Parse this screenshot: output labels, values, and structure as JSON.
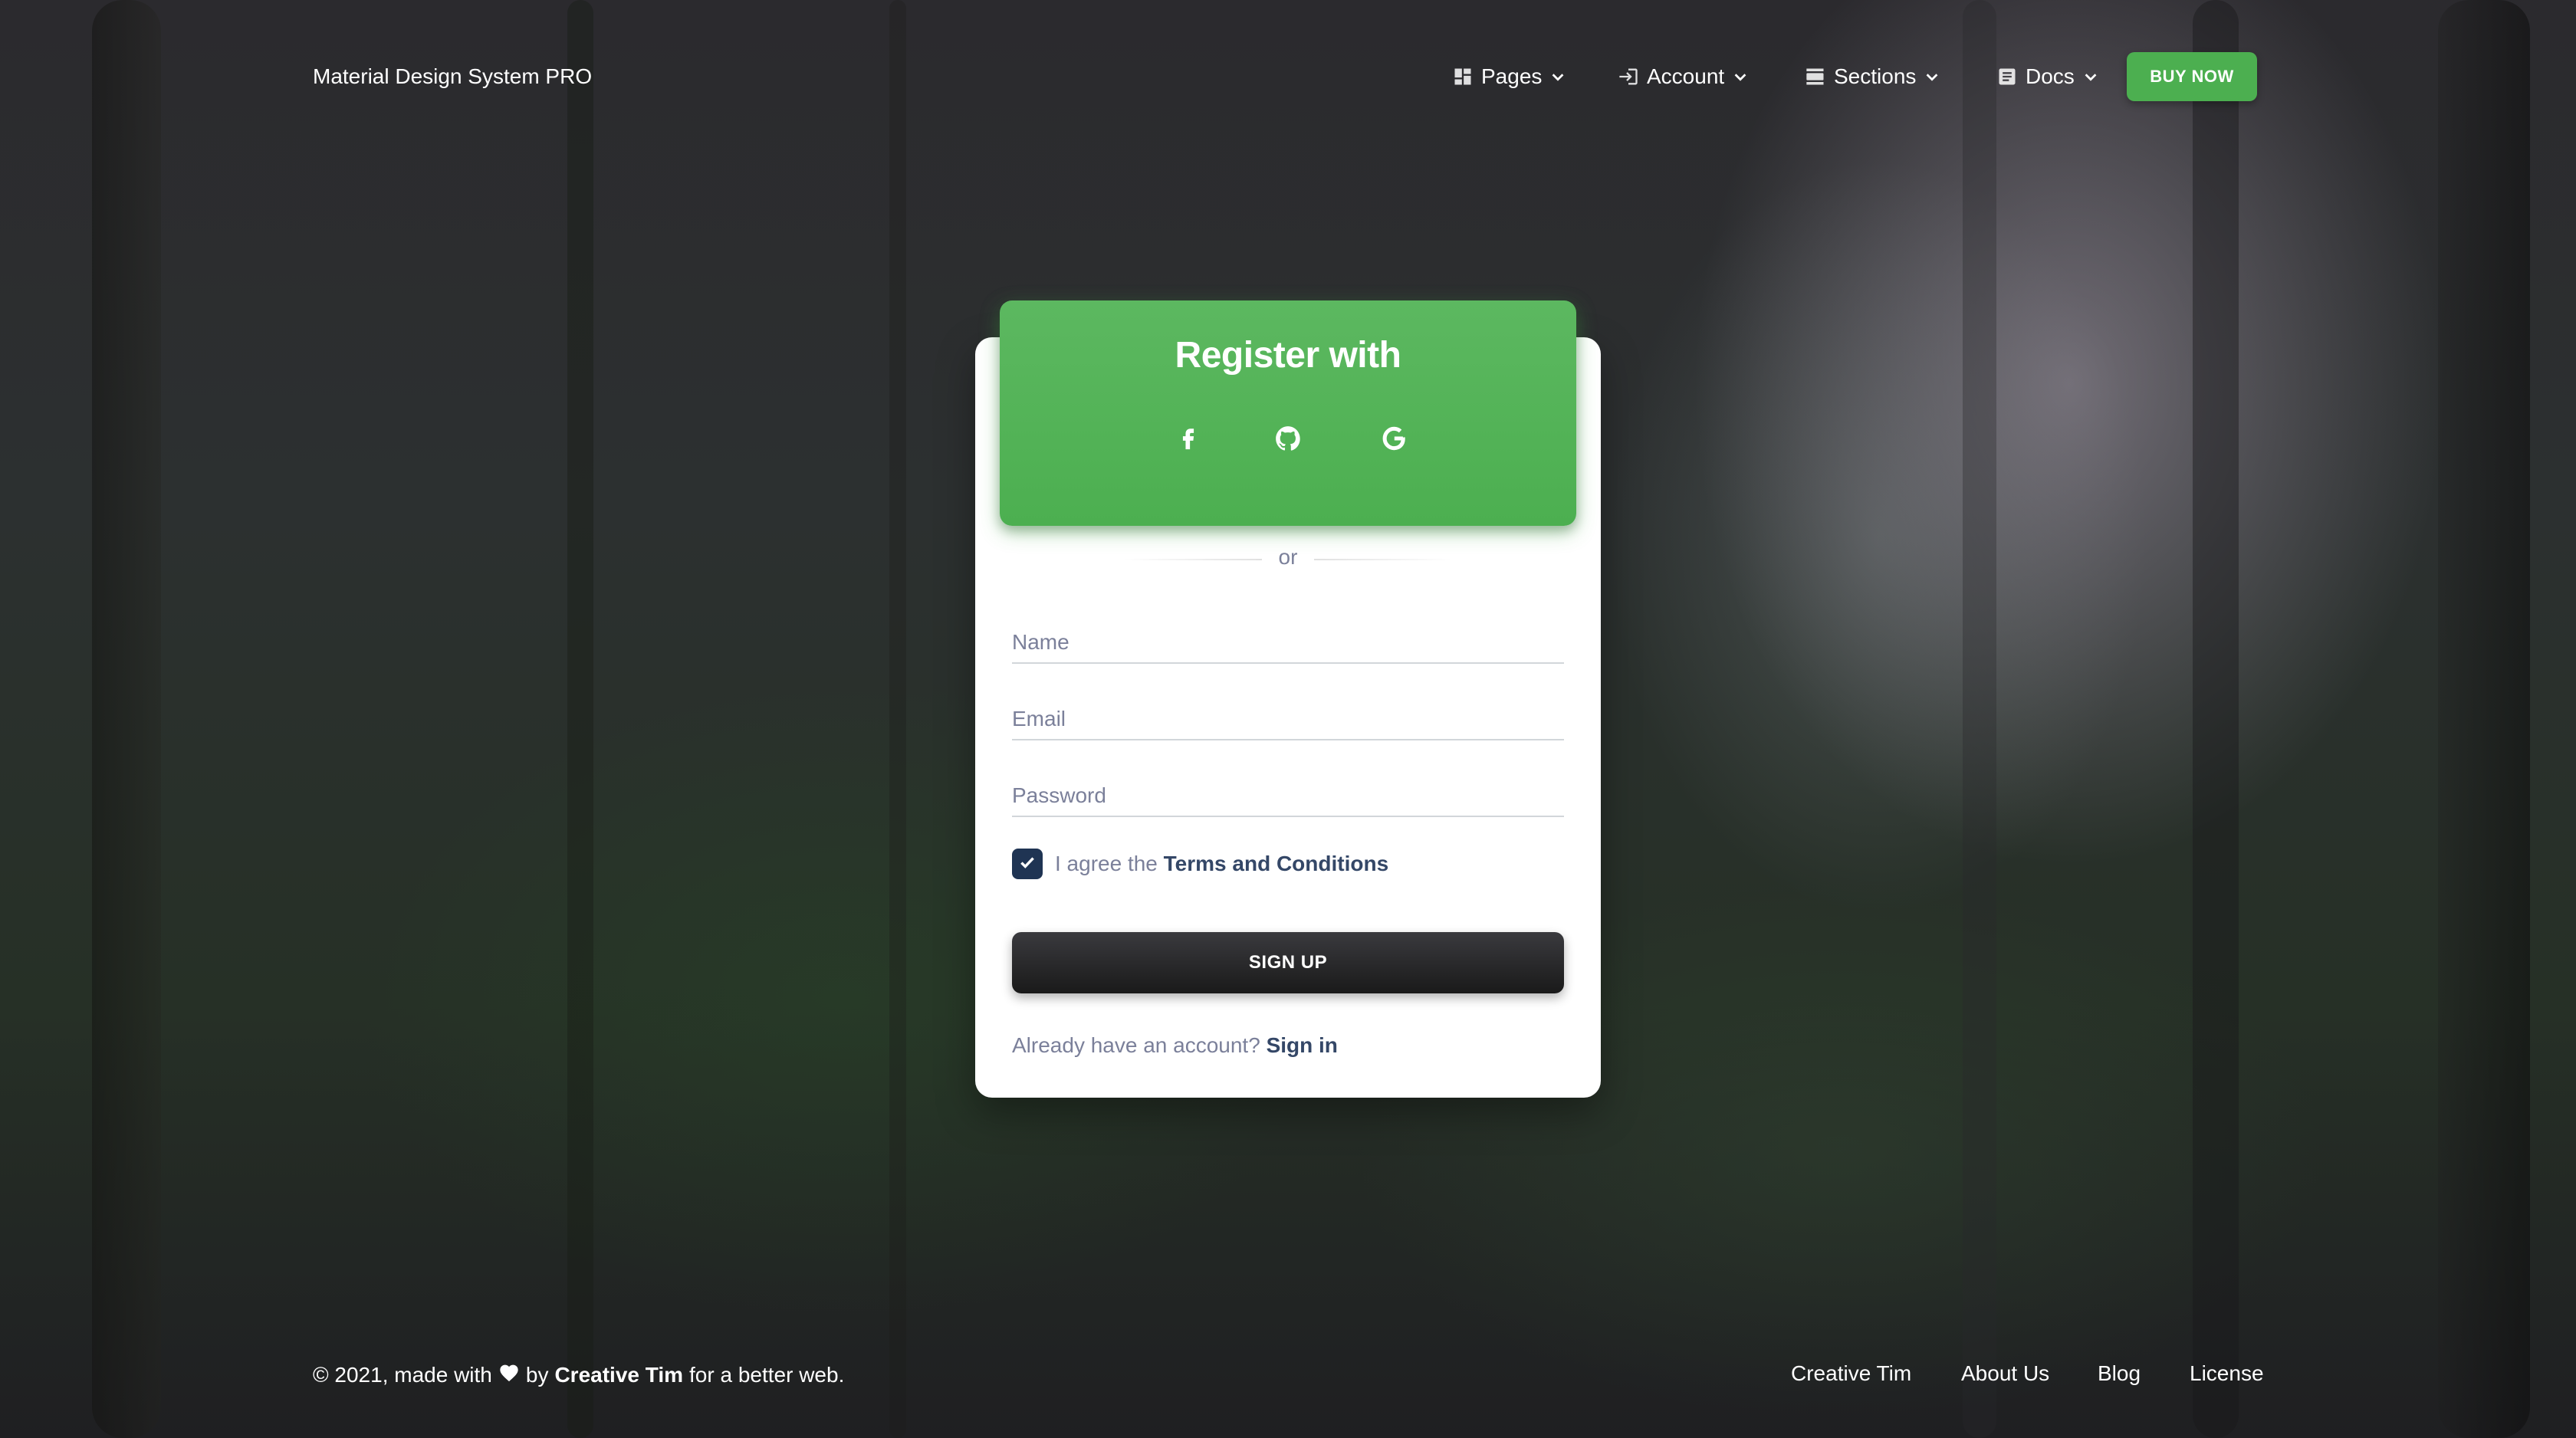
{
  "navbar": {
    "brand": "Material Design System PRO",
    "items": [
      {
        "label": "Pages",
        "icon": "dashboard-icon"
      },
      {
        "label": "Account",
        "icon": "login-icon"
      },
      {
        "label": "Sections",
        "icon": "view-day-icon"
      },
      {
        "label": "Docs",
        "icon": "article-icon"
      }
    ],
    "cta_label": "BUY NOW"
  },
  "card": {
    "title": "Register with",
    "social": [
      "facebook-icon",
      "github-icon",
      "google-icon"
    ],
    "divider_text": "or",
    "fields": {
      "name_placeholder": "Name",
      "email_placeholder": "Email",
      "password_placeholder": "Password"
    },
    "terms": {
      "checked": true,
      "prefix": "I agree the",
      "link": "Terms and Conditions"
    },
    "submit_label": "SIGN UP",
    "signin": {
      "prefix": "Already have an account?",
      "link": "Sign in"
    }
  },
  "footer": {
    "copy_prefix": "© 2021, made with",
    "copy_by": "by",
    "copy_author": "Creative Tim",
    "copy_suffix": "for a better web.",
    "links": [
      "Creative Tim",
      "About Us",
      "Blog",
      "License"
    ]
  },
  "colors": {
    "accent_green": "#4caf50",
    "dark_button": "#1a1a1a",
    "text_dark": "#344767",
    "text_muted": "#7b809a"
  }
}
